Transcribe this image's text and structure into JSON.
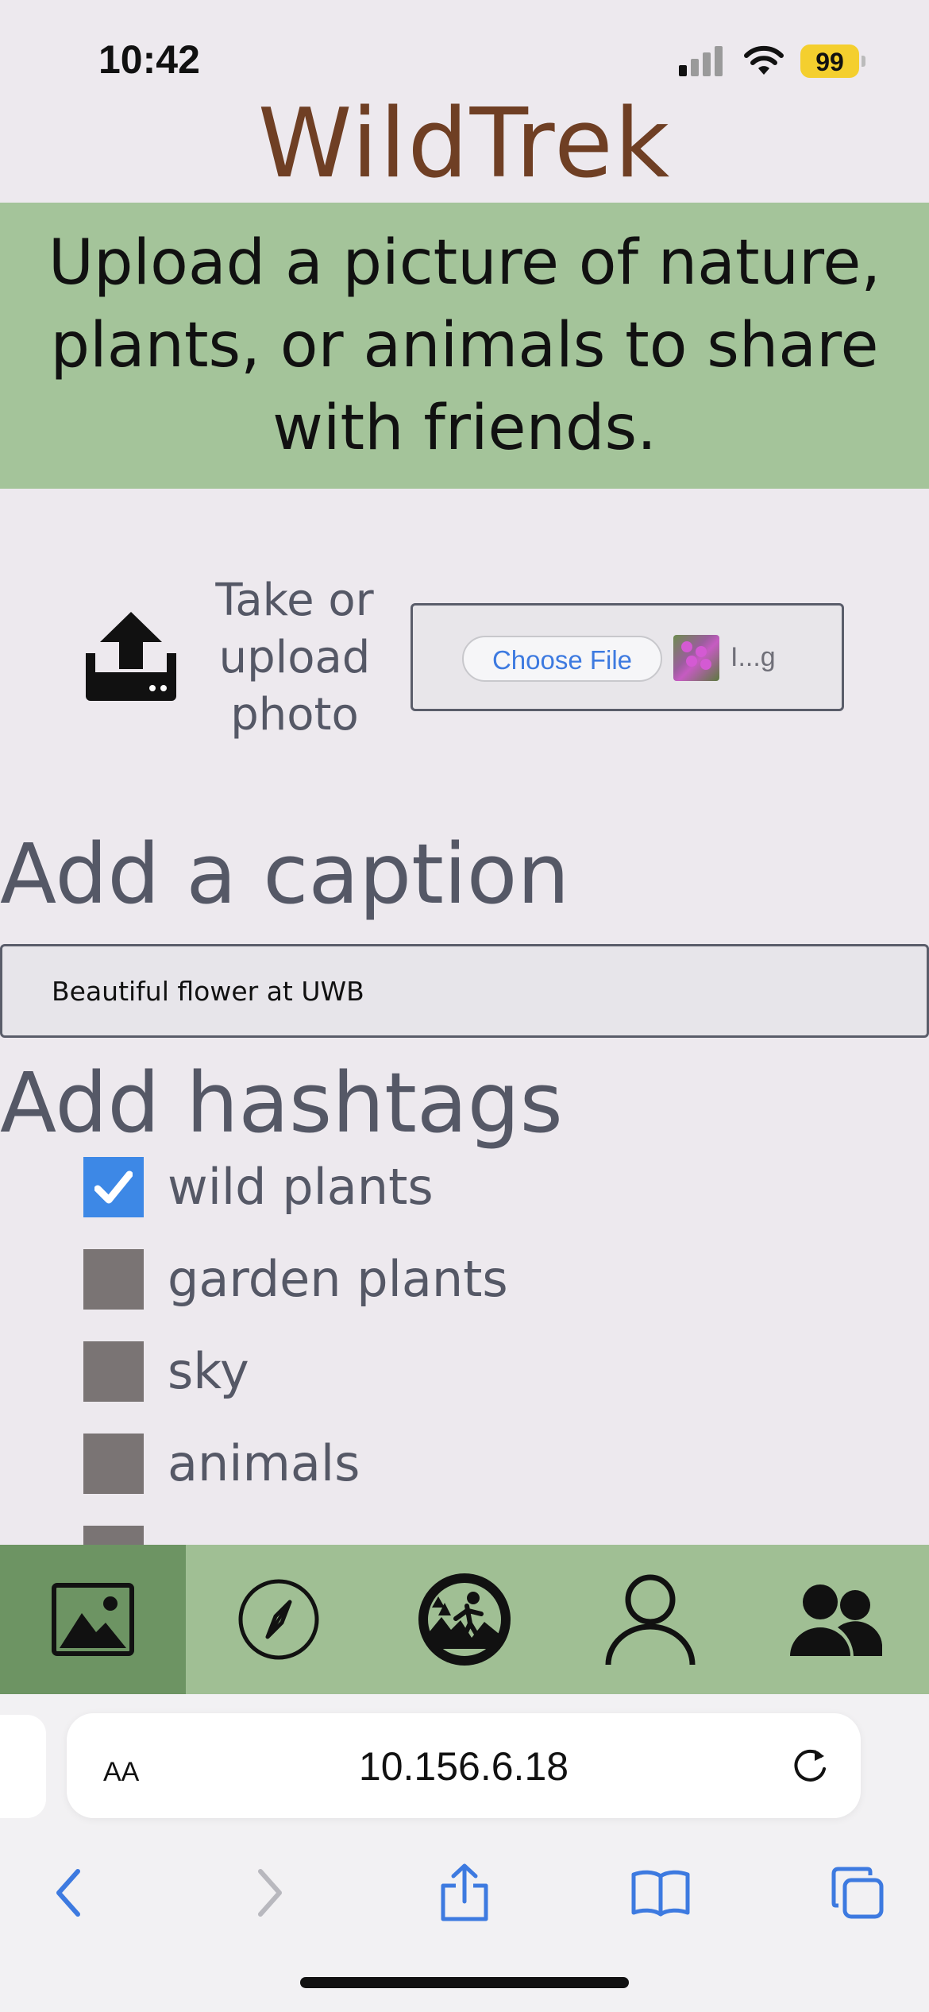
{
  "status_bar": {
    "time": "10:42",
    "battery": "99"
  },
  "app": {
    "title": "WildTrek"
  },
  "intro": {
    "text": "Upload a picture of nature, plants, or animals to share with friends."
  },
  "upload": {
    "label": "Take or upload photo",
    "choose_file_label": "Choose File",
    "file_name": "I...g"
  },
  "caption": {
    "heading": "Add a caption",
    "value": "Beautiful flower at UWB"
  },
  "hashtags": {
    "heading": "Add hashtags",
    "items": [
      {
        "label": "wild plants",
        "checked": true
      },
      {
        "label": "garden plants",
        "checked": false
      },
      {
        "label": "sky",
        "checked": false
      },
      {
        "label": "animals",
        "checked": false
      }
    ]
  },
  "bottom_nav": {
    "items": [
      {
        "icon": "image-icon",
        "active": true
      },
      {
        "icon": "compass-icon",
        "active": false
      },
      {
        "icon": "hiker-logo-icon",
        "active": false
      },
      {
        "icon": "person-icon",
        "active": false
      },
      {
        "icon": "people-icon",
        "active": false
      }
    ]
  },
  "browser": {
    "text_size_label": "AA",
    "url": "10.156.6.18",
    "toolbar_icons": [
      "back-icon",
      "forward-icon",
      "share-icon",
      "bookmarks-icon",
      "tabs-icon"
    ],
    "accent_color": "#3d7ae0"
  },
  "colors": {
    "banner": "#a4c49a",
    "nav": "#a0bf94",
    "nav_active": "#6d9463",
    "title": "#6f3f24"
  }
}
